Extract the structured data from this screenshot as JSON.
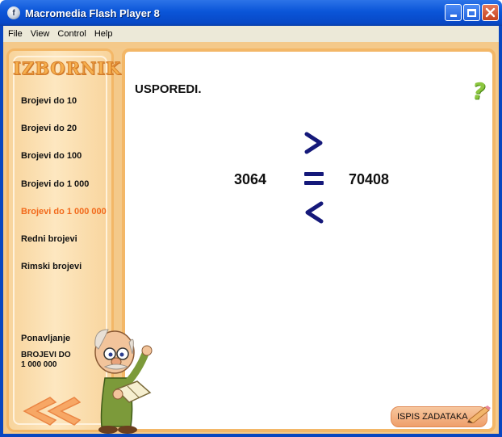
{
  "window": {
    "title": "Macromedia Flash Player 8",
    "title_bar_color": "#0a55d8"
  },
  "menu": {
    "items": [
      "File",
      "View",
      "Control",
      "Help"
    ]
  },
  "sidebar": {
    "logo_text": "IZBORNIK",
    "items": [
      {
        "label": "Brojevi do 10",
        "active": false
      },
      {
        "label": "Brojevi do 20",
        "active": false
      },
      {
        "label": "Brojevi do 100",
        "active": false
      },
      {
        "label": "Brojevi do 1 000",
        "active": false
      },
      {
        "label": "Brojevi do 1 000 000",
        "active": true
      },
      {
        "label": "Redni brojevi",
        "active": false
      },
      {
        "label": "Rimski brojevi",
        "active": false
      }
    ],
    "review_heading": "Ponavljanje",
    "review_topic_line1": "BROJEVI DO",
    "review_topic_line2": "1 000 000",
    "active_color": "#f26a1b"
  },
  "exercise": {
    "instruction": "USPOREDI.",
    "left_number": "3064",
    "right_number": "70408",
    "operators": [
      "greater-than",
      "equals",
      "less-than"
    ],
    "operator_color": "#15197a",
    "help_icon": "question-mark-icon",
    "help_color": "#8cc63f"
  },
  "footer": {
    "print_button_label": "ISPIS ZADATAKA",
    "back_icon": "double-chevron-left-icon"
  },
  "colors": {
    "frame_orange": "#f3b767",
    "sidebar_background": "#fde7c0"
  }
}
